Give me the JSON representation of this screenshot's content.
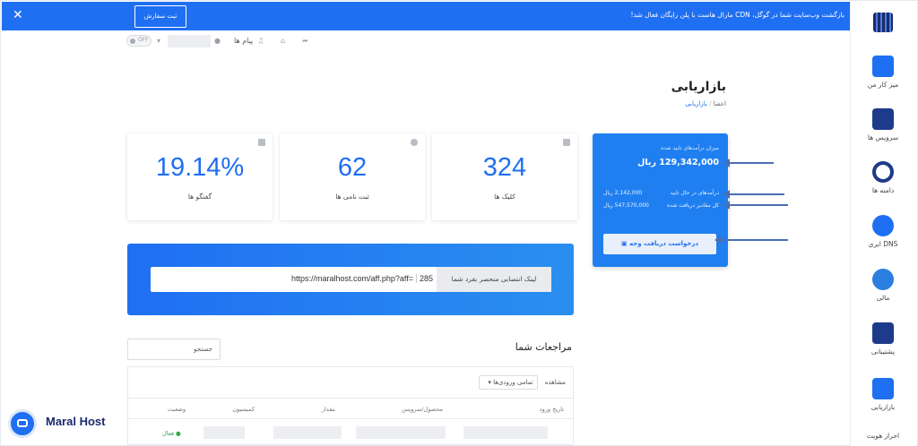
{
  "banner": {
    "close_icon": "close-icon",
    "register_label": "ثبت سفارش",
    "message": "بازگشت وب‌سایت شما در گوگل، CDN مارال هاست با پلن رایگان فعال شد!"
  },
  "toolbar": {
    "messages_label": "پیام ها",
    "toggle_label": "OFF"
  },
  "sidebar": {
    "items": [
      {
        "label": "میز کار من",
        "icon": "desk-icon"
      },
      {
        "label": "سرویس ها",
        "icon": "services-icon"
      },
      {
        "label": "دامنه ها",
        "icon": "domains-icon"
      },
      {
        "label": "DNS ابری",
        "icon": "cloud-dns-icon"
      },
      {
        "label": "مالی",
        "icon": "finance-icon"
      },
      {
        "label": "پشتیبانی",
        "icon": "support-icon"
      },
      {
        "label": "بازاریابی",
        "icon": "marketing-icon"
      },
      {
        "label": "احراز هویت",
        "icon": "identity-icon"
      }
    ]
  },
  "page": {
    "title": "بازاریابی",
    "breadcrumb": [
      "اعضا",
      "بازاریابی"
    ]
  },
  "stats": [
    {
      "value": "19.14%",
      "label": "گفتگو ها"
    },
    {
      "value": "62",
      "label": "ثبت نامی ها"
    },
    {
      "value": "324",
      "label": "کلیک ها"
    }
  ],
  "balance": {
    "approved_title": "میزان درآمدهای تایید شده",
    "approved_amount": "129,342,000 ریال",
    "pending_label": "درآمدهای در حال تایید",
    "pending_value": "2,142,000 ریال",
    "total_label": "کل مقادیر دریافت شده",
    "total_value": "547,570,000 ریال",
    "withdraw_label": "درخواست دریافت وجه"
  },
  "link": {
    "label": "لینک انتصابی منحصر بفرد شما",
    "url": "https://maralhost.com/aff.php?aff=",
    "aff_id": "285"
  },
  "referrals": {
    "title": "مراجعات شما",
    "search_placeholder": "جستجو",
    "view_label": "مشاهده",
    "filter_value": "تمامی ورودی‌ها",
    "columns": [
      "تاریخ ورود",
      "محصول/سرویس",
      "مقدار",
      "کمیسیون",
      "وضعیت"
    ],
    "status": "فعال"
  },
  "brand": {
    "name": "Maral Host",
    "accent": "#1f6ff2"
  }
}
